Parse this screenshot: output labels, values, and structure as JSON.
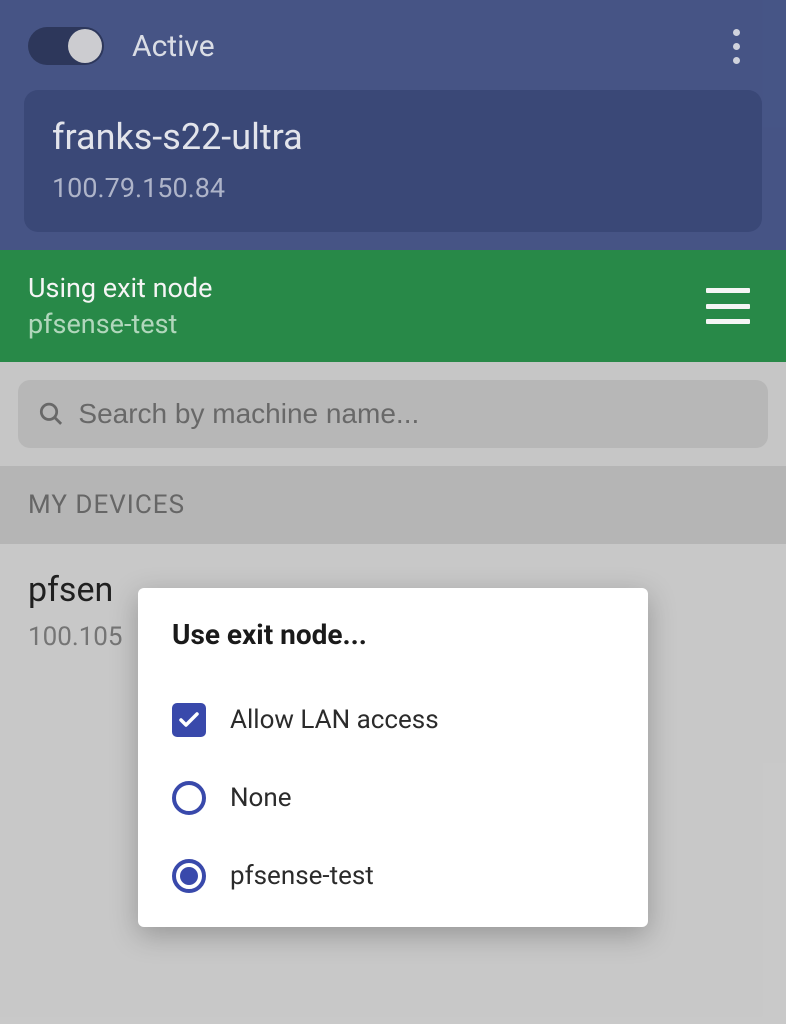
{
  "header": {
    "status_label": "Active",
    "toggle_on": true
  },
  "device": {
    "name": "franks-s22-ultra",
    "ip": "100.79.150.84"
  },
  "exit_node": {
    "title": "Using exit node",
    "name": "pfsense-test"
  },
  "search": {
    "placeholder": "Search by machine name..."
  },
  "sections": {
    "my_devices_label": "MY DEVICES"
  },
  "devices": [
    {
      "name": "pfsen",
      "ip": "100.105"
    }
  ],
  "dialog": {
    "title": "Use exit node...",
    "allow_lan_label": "Allow LAN access",
    "allow_lan_checked": true,
    "options": [
      {
        "label": "None",
        "selected": false
      },
      {
        "label": "pfsense-test",
        "selected": true
      }
    ]
  },
  "colors": {
    "primary_blue": "#49588b",
    "accent_green": "#2a8f4b",
    "indigo": "#3949ab"
  }
}
